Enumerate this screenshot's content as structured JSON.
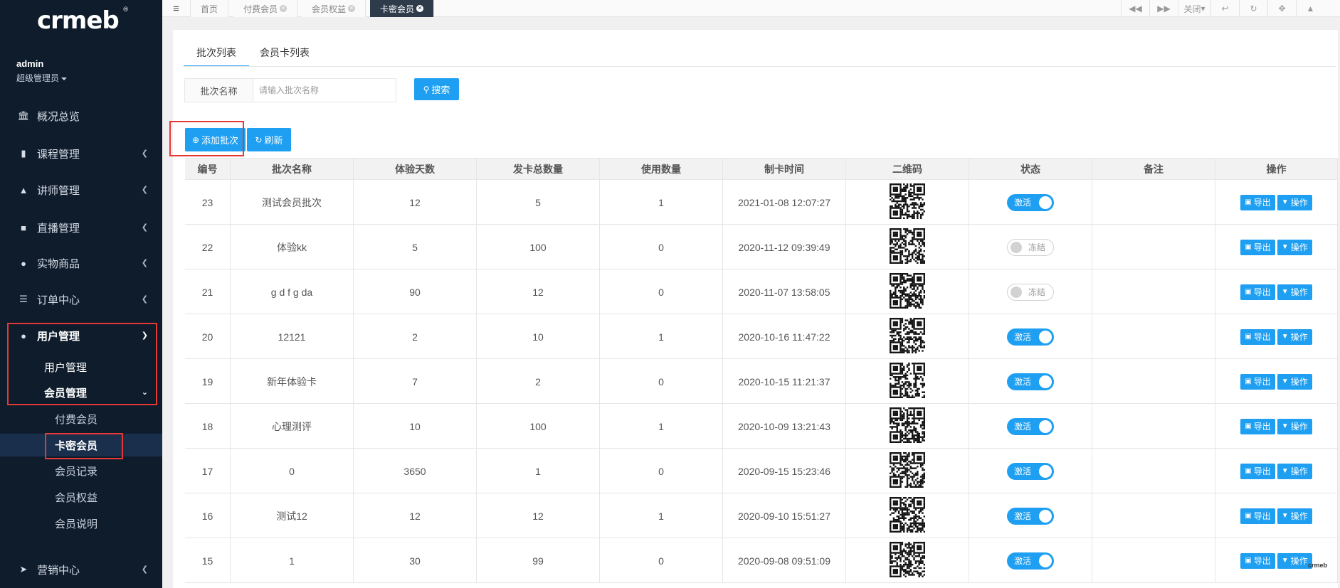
{
  "brand": {
    "logo_text": "crmeb",
    "registered_mark": "®"
  },
  "user": {
    "name": "admin",
    "role": "超级管理员"
  },
  "sidebar": {
    "items": [
      {
        "label": "概况总览",
        "icon": "bank-icon"
      },
      {
        "label": "课程管理",
        "icon": "book-icon"
      },
      {
        "label": "讲师管理",
        "icon": "graduation-cap-icon"
      },
      {
        "label": "直播管理",
        "icon": "video-camera-icon"
      },
      {
        "label": "实物商品",
        "icon": "cart-icon"
      },
      {
        "label": "订单中心",
        "icon": "list-icon"
      },
      {
        "label": "用户管理",
        "icon": "user-icon"
      },
      {
        "label": "营销中心",
        "icon": "paper-plane-icon"
      }
    ],
    "user_submenu": [
      "用户管理",
      "会员管理"
    ],
    "member_submenu": [
      "付费会员",
      "卡密会员",
      "会员记录",
      "会员权益",
      "会员说明"
    ]
  },
  "topbar": {
    "tabs": [
      "首页",
      "付费会员",
      "会员权益",
      "卡密会员"
    ],
    "close_label": "关闭"
  },
  "content": {
    "tabs": [
      "批次列表",
      "会员卡列表"
    ],
    "search_label": "批次名称",
    "search_placeholder": "请输入批次名称",
    "search_button": "搜索",
    "add_button": "添加批次",
    "refresh_button": "刷新"
  },
  "table": {
    "headers": [
      "编号",
      "批次名称",
      "体验天数",
      "发卡总数量",
      "使用数量",
      "制卡时间",
      "二维码",
      "状态",
      "备注",
      "操作"
    ],
    "rows": [
      {
        "id": "23",
        "name": "测试会员批次",
        "days": "12",
        "total": "5",
        "used": "1",
        "time": "2021-01-08 12:07:27",
        "status": "激活",
        "active": true,
        "note": ""
      },
      {
        "id": "22",
        "name": "体验kk",
        "days": "5",
        "total": "100",
        "used": "0",
        "time": "2020-11-12 09:39:49",
        "status": "冻结",
        "active": false,
        "note": ""
      },
      {
        "id": "21",
        "name": "g d f g da",
        "days": "90",
        "total": "12",
        "used": "0",
        "time": "2020-11-07 13:58:05",
        "status": "冻结",
        "active": false,
        "note": ""
      },
      {
        "id": "20",
        "name": "12121",
        "days": "2",
        "total": "10",
        "used": "1",
        "time": "2020-10-16 11:47:22",
        "status": "激活",
        "active": true,
        "note": ""
      },
      {
        "id": "19",
        "name": "新年体验卡",
        "days": "7",
        "total": "2",
        "used": "0",
        "time": "2020-10-15 11:21:37",
        "status": "激活",
        "active": true,
        "note": ""
      },
      {
        "id": "18",
        "name": "心理测评",
        "days": "10",
        "total": "100",
        "used": "1",
        "time": "2020-10-09 13:21:43",
        "status": "激活",
        "active": true,
        "note": ""
      },
      {
        "id": "17",
        "name": "0",
        "days": "3650",
        "total": "1",
        "used": "0",
        "time": "2020-09-15 15:23:46",
        "status": "激活",
        "active": true,
        "note": ""
      },
      {
        "id": "16",
        "name": "测试12",
        "days": "12",
        "total": "12",
        "used": "1",
        "time": "2020-09-10 15:51:27",
        "status": "激活",
        "active": true,
        "note": ""
      },
      {
        "id": "15",
        "name": "1",
        "days": "30",
        "total": "99",
        "used": "0",
        "time": "2020-09-08 09:51:09",
        "status": "激活",
        "active": true,
        "note": ""
      }
    ],
    "export_label": "导出",
    "action_label": "操作"
  },
  "colors": {
    "primary": "#1e9ff2",
    "sidebar_bg": "#0f1c2c",
    "highlight_frame": "#e53935",
    "active_tab": "#2e3b4b"
  },
  "watermark": "crmeb"
}
